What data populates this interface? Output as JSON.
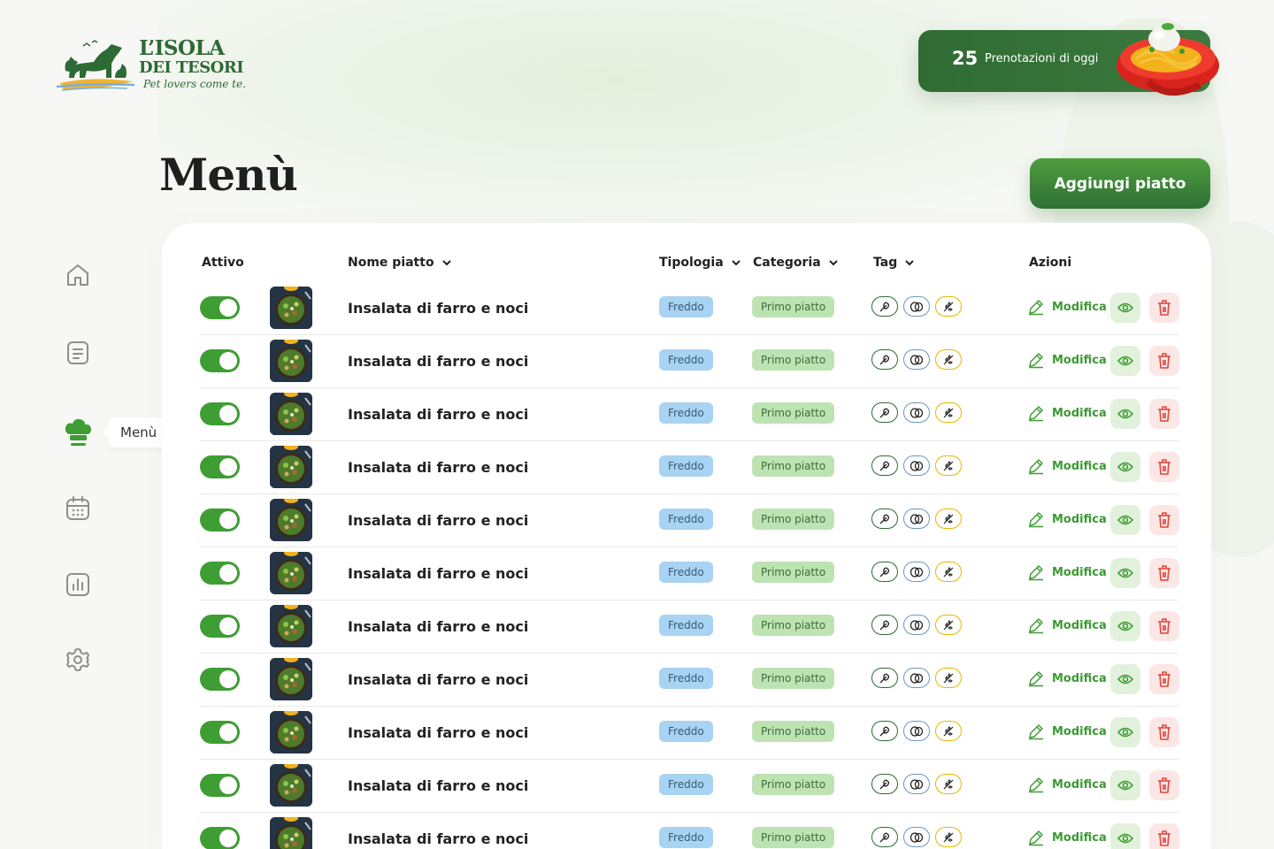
{
  "brand": {
    "title": "L’ISOLA",
    "subtitle": "DEI TESORI",
    "tagline": "Pet lovers come te."
  },
  "bookings": {
    "count": "25",
    "label": "Prenotazioni di oggi"
  },
  "page": {
    "title": "Menù",
    "add_button": "Aggiungi piatto"
  },
  "sidebar": {
    "items": [
      {
        "icon": "home-icon"
      },
      {
        "icon": "document-icon"
      },
      {
        "icon": "chef-hat-icon",
        "label": "Menù",
        "active": true
      },
      {
        "icon": "calendar-icon"
      },
      {
        "icon": "chart-icon"
      },
      {
        "icon": "settings-icon"
      }
    ]
  },
  "table": {
    "headers": {
      "active": "Attivo",
      "name": "Nome piatto",
      "type": "Tipologia",
      "category": "Categoria",
      "tag": "Tag",
      "actions": "Azioni"
    },
    "edit_label": "Modifica",
    "rows": [
      {
        "active": true,
        "name": "Insalata di farro e noci",
        "type": "Freddo",
        "category": "Primo piatto"
      },
      {
        "active": true,
        "name": "Insalata di farro e noci",
        "type": "Freddo",
        "category": "Primo piatto"
      },
      {
        "active": true,
        "name": "Insalata di farro e noci",
        "type": "Freddo",
        "category": "Primo piatto"
      },
      {
        "active": true,
        "name": "Insalata di farro e noci",
        "type": "Freddo",
        "category": "Primo piatto"
      },
      {
        "active": true,
        "name": "Insalata di farro e noci",
        "type": "Freddo",
        "category": "Primo piatto"
      },
      {
        "active": true,
        "name": "Insalata di farro e noci",
        "type": "Freddo",
        "category": "Primo piatto"
      },
      {
        "active": true,
        "name": "Insalata di farro e noci",
        "type": "Freddo",
        "category": "Primo piatto"
      },
      {
        "active": true,
        "name": "Insalata di farro e noci",
        "type": "Freddo",
        "category": "Primo piatto"
      },
      {
        "active": true,
        "name": "Insalata di farro e noci",
        "type": "Freddo",
        "category": "Primo piatto"
      },
      {
        "active": true,
        "name": "Insalata di farro e noci",
        "type": "Freddo",
        "category": "Primo piatto"
      },
      {
        "active": true,
        "name": "Insalata di farro e noci",
        "type": "Freddo",
        "category": "Primo piatto"
      }
    ]
  },
  "colors": {
    "brand_green": "#2e6a35",
    "accent_green": "#3e9d33",
    "delete_red": "#e0453a",
    "type_blue": "#a9d3f2",
    "category_green": "#bde3b3"
  }
}
